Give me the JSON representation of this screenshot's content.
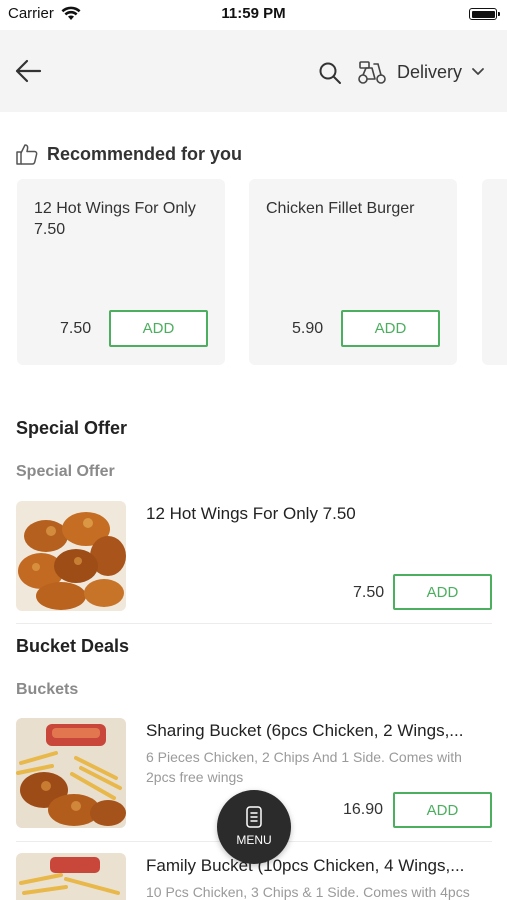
{
  "status_bar": {
    "carrier": "Carrier",
    "time": "11:59 PM"
  },
  "header": {
    "delivery_label": "Delivery",
    "icons": [
      "back-arrow-icon",
      "search-icon",
      "scooter-icon",
      "chevron-down-icon"
    ]
  },
  "recommended": {
    "title": "Recommended for you",
    "items": [
      {
        "name": "12 Hot Wings For Only 7.50",
        "price": "7.50",
        "button": "ADD"
      },
      {
        "name": "Chicken Fillet Burger",
        "price": "5.90",
        "button": "ADD"
      }
    ]
  },
  "sections": [
    {
      "title": "Special Offer",
      "subtitle": "Special Offer",
      "items": [
        {
          "name": "12 Hot Wings For Only 7.50",
          "description": "",
          "price": "7.50",
          "button": "ADD"
        }
      ]
    },
    {
      "title": "Bucket Deals",
      "subtitle": "Buckets",
      "items": [
        {
          "name": "Sharing Bucket (6pcs Chicken, 2 Wings,...",
          "description": "6 Pieces Chicken, 2 Chips And 1 Side. Comes with 2pcs free wings",
          "price": "16.90",
          "button": "ADD"
        },
        {
          "name": "Family Bucket (10pcs Chicken, 4 Wings,...",
          "description": "10 Pcs Chicken, 3 Chips & 1 Side. Comes with 4pcs",
          "price": "",
          "button": ""
        }
      ]
    }
  ],
  "menu_button": {
    "label": "MENU"
  },
  "colors": {
    "accent": "#4cae5f",
    "header_bg": "#f4f4f4",
    "card_bg": "#f5f5f5",
    "fab_bg": "#2b2b2b"
  }
}
